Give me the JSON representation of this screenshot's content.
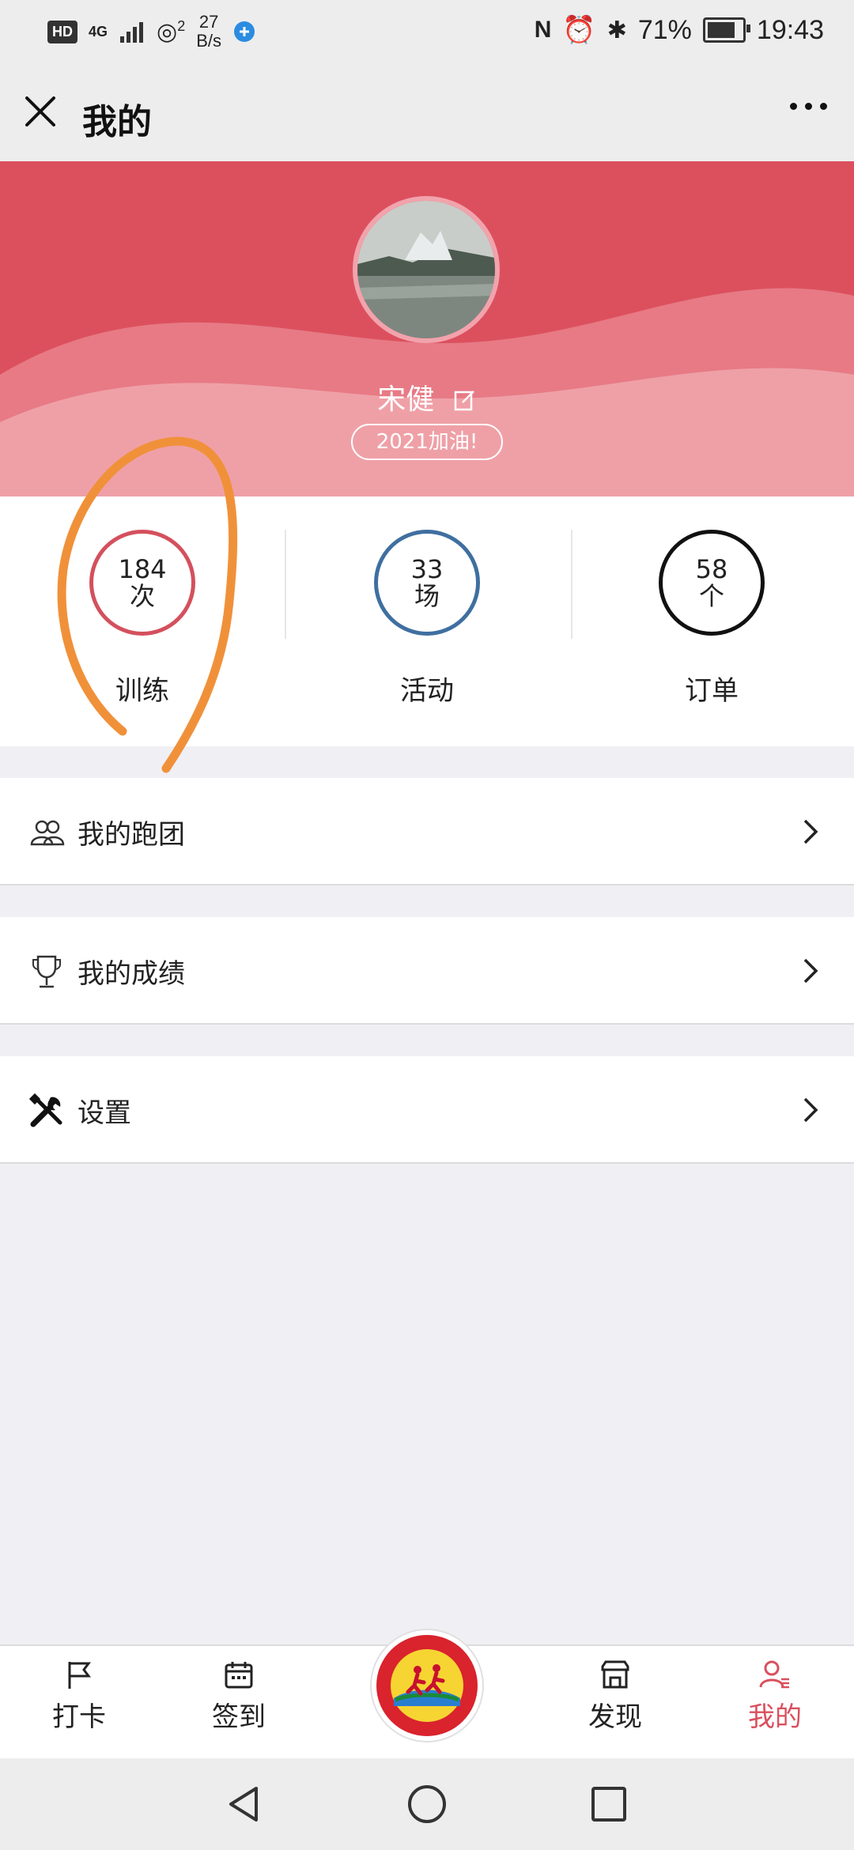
{
  "status_bar": {
    "hd": "HD",
    "network": "4G",
    "hotspot_count": "2",
    "speed_value": "27",
    "speed_unit": "B/s",
    "battery": "71%",
    "battery_level": 0.71,
    "time": "19:43"
  },
  "nav": {
    "title": "我的"
  },
  "profile": {
    "name": "宋健",
    "motto": "2021加油!"
  },
  "stats": [
    {
      "number": "184",
      "unit": "次",
      "label": "训练",
      "color": "#d4505d"
    },
    {
      "number": "33",
      "unit": "场",
      "label": "活动",
      "color": "#3f6fa0"
    },
    {
      "number": "58",
      "unit": "个",
      "label": "订单",
      "color": "#111111"
    }
  ],
  "menu": [
    {
      "label": "我的跑团",
      "icon": "group-icon"
    },
    {
      "label": "我的成绩",
      "icon": "trophy-icon"
    },
    {
      "label": "设置",
      "icon": "tools-icon"
    }
  ],
  "tabs": [
    {
      "label": "打卡",
      "icon": "flag-icon",
      "active": false
    },
    {
      "label": "签到",
      "icon": "calendar-icon",
      "active": false
    },
    {
      "label": "发现",
      "icon": "store-icon",
      "active": false
    },
    {
      "label": "我的",
      "icon": "user-icon",
      "active": true
    }
  ],
  "colors": {
    "brand": "#dc505e",
    "active_tab": "#d9505e",
    "annotation": "#f0913a"
  }
}
